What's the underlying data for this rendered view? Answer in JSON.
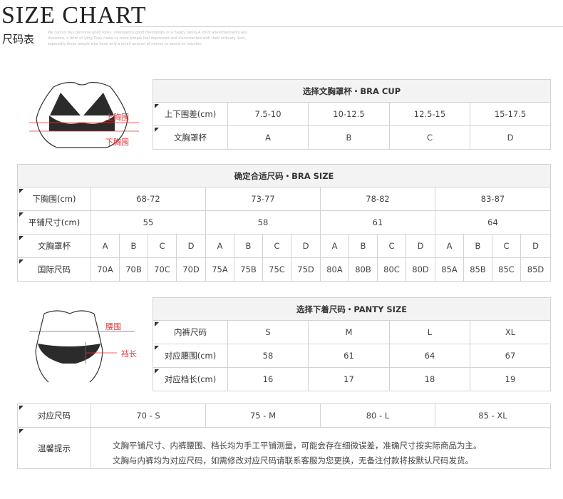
{
  "header": {
    "title": "SIZE CHART",
    "subtitle": "尺码表",
    "blurb": "We cannot buy personal good looks, intelligence,good friendships or a happy family.A lot of advertisements are, therefore, a form of lying.They make us more people feel depressed and discontented with their ordinary lives, especially those people who have only a small amount of money to spend on luxuries."
  },
  "bra_cup": {
    "header": "选择文胸罩杯・BRA CUP",
    "diagram_labels": {
      "upper": "上胸围",
      "lower": "下胸围"
    },
    "rows": [
      {
        "label": "上下围差(cm)",
        "cells": [
          "7.5-10",
          "10-12.5",
          "12.5-15",
          "15-17.5"
        ]
      },
      {
        "label": "文胸罩杯",
        "cells": [
          "A",
          "B",
          "C",
          "D"
        ]
      }
    ]
  },
  "bra_size": {
    "header": "确定合适尺码・BRA SIZE",
    "underbust": {
      "label": "下胸围(cm)",
      "cells": [
        "68-72",
        "73-77",
        "78-82",
        "83-87"
      ]
    },
    "flat": {
      "label": "平铺尺寸(cm)",
      "cells": [
        "55",
        "58",
        "61",
        "64"
      ]
    },
    "cup": {
      "label": "文胸罩杯",
      "cells": [
        "A",
        "B",
        "C",
        "D",
        "A",
        "B",
        "C",
        "D",
        "A",
        "B",
        "C",
        "D",
        "A",
        "B",
        "C",
        "D"
      ]
    },
    "intl": {
      "label": "国际尺码",
      "cells": [
        "70A",
        "70B",
        "70C",
        "70D",
        "75A",
        "75B",
        "75C",
        "75D",
        "80A",
        "80B",
        "80C",
        "80D",
        "85A",
        "85B",
        "85C",
        "85D"
      ]
    }
  },
  "panty": {
    "header": "选择下着尺码・PANTY SIZE",
    "diagram_labels": {
      "waist": "腰围",
      "rise": "裆长"
    },
    "rows": [
      {
        "label": "内裤尺码",
        "cells": [
          "S",
          "M",
          "L",
          "XL"
        ]
      },
      {
        "label": "对应腰围(cm)",
        "cells": [
          "58",
          "61",
          "64",
          "67"
        ]
      },
      {
        "label": "对应档长(cm)",
        "cells": [
          "16",
          "17",
          "18",
          "19"
        ]
      }
    ]
  },
  "matching": {
    "label": "对应尺码",
    "cells": [
      "70 - S",
      "75 - M",
      "80 - L",
      "85 - XL"
    ],
    "tip_label": "温馨提示",
    "notes": [
      "文胸平铺尺寸、内裤腰围、档长均为手工平铺测量，可能会存在细微误差，准确尺寸按实际商品为主。",
      "文胸与内裤均为对应尺码，如需修改对应尺码请联系客服为您更换，无备注付款将按默认尺码发货。"
    ]
  },
  "colors": {
    "accent": "#e4393c",
    "border": "#d3d3d3",
    "header_bg": "#f3f3f3"
  }
}
